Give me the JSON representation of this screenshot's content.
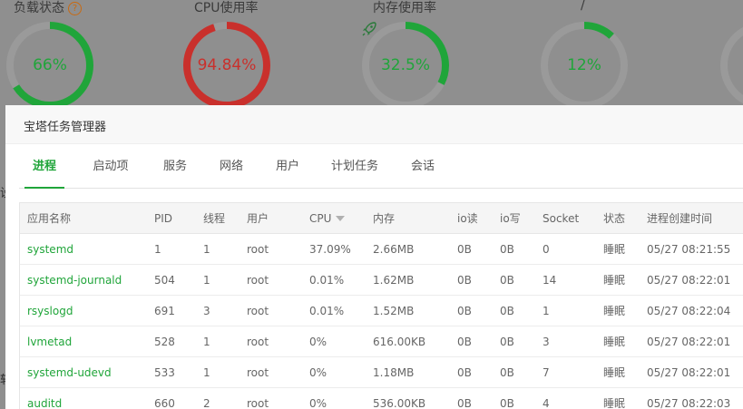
{
  "dashboard": {
    "gauges": [
      {
        "title": "负载状态",
        "help": "?",
        "value": "66%",
        "percent": 0.66,
        "color": "#20a53a"
      },
      {
        "title": "CPU使用率",
        "help": "",
        "value": "94.84%",
        "percent": 0.9484,
        "color": "#c9302c"
      },
      {
        "title": "内存使用率",
        "help": "",
        "value": "32.5%",
        "percent": 0.325,
        "color": "#20a53a"
      },
      {
        "title": "/",
        "help": "",
        "value": "12%",
        "percent": 0.12,
        "color": "#20a53a"
      },
      {
        "title": "",
        "help": "",
        "value": "",
        "percent": 0.3,
        "color": "#20a53a"
      }
    ],
    "side_glyphs": [
      "设",
      "软"
    ]
  },
  "modal": {
    "title": "宝塔任务管理器",
    "tabs": [
      {
        "label": "进程",
        "active": true
      },
      {
        "label": "启动项",
        "active": false
      },
      {
        "label": "服务",
        "active": false
      },
      {
        "label": "网络",
        "active": false
      },
      {
        "label": "用户",
        "active": false
      },
      {
        "label": "计划任务",
        "active": false
      },
      {
        "label": "会话",
        "active": false
      }
    ],
    "table": {
      "columns": [
        "应用名称",
        "PID",
        "线程",
        "用户",
        "CPU",
        "内存",
        "io读",
        "io写",
        "Socket",
        "状态",
        "进程创建时间"
      ],
      "sorted_column": "CPU",
      "rows": [
        [
          "systemd",
          "1",
          "1",
          "root",
          "37.09%",
          "2.66MB",
          "0B",
          "0B",
          "0",
          "睡眠",
          "05/27 08:21:55"
        ],
        [
          "systemd-journald",
          "504",
          "1",
          "root",
          "0.01%",
          "1.62MB",
          "0B",
          "0B",
          "14",
          "睡眠",
          "05/27 08:22:01"
        ],
        [
          "rsyslogd",
          "691",
          "3",
          "root",
          "0.01%",
          "1.52MB",
          "0B",
          "0B",
          "1",
          "睡眠",
          "05/27 08:22:04"
        ],
        [
          "lvmetad",
          "528",
          "1",
          "root",
          "0%",
          "616.00KB",
          "0B",
          "0B",
          "3",
          "睡眠",
          "05/27 08:22:01"
        ],
        [
          "systemd-udevd",
          "533",
          "1",
          "root",
          "0%",
          "1.18MB",
          "0B",
          "0B",
          "7",
          "睡眠",
          "05/27 08:22:01"
        ],
        [
          "auditd",
          "660",
          "2",
          "root",
          "0%",
          "536.00KB",
          "0B",
          "0B",
          "4",
          "睡眠",
          "05/27 08:22:03"
        ]
      ]
    }
  }
}
